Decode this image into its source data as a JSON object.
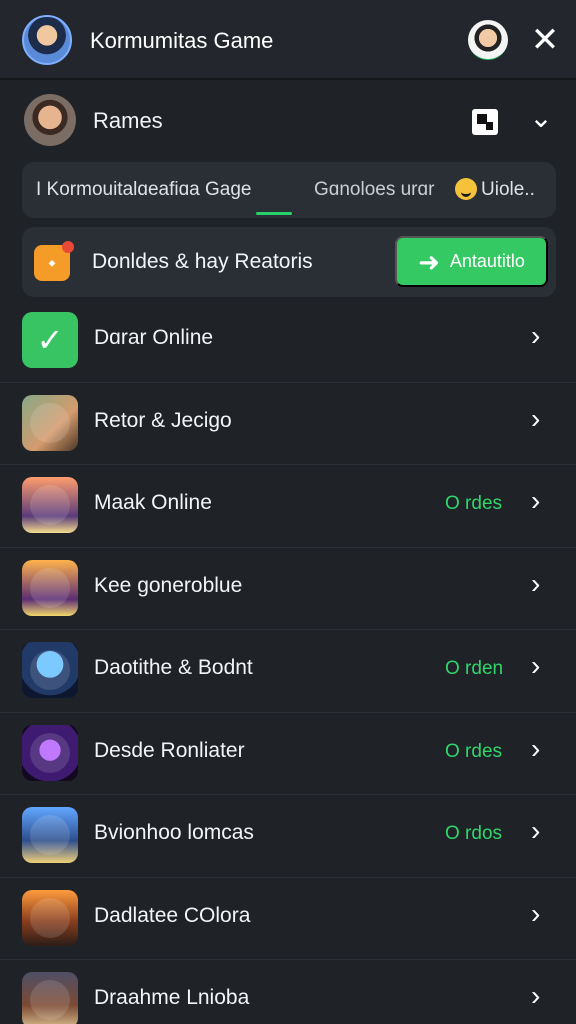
{
  "header": {
    "title": "Kormumitas Game"
  },
  "profile": {
    "name": "Rames"
  },
  "tabs": [
    {
      "label": "I  Kormouitalɑeafiɑa Gage"
    },
    {
      "label": "Gɑnoloes urɑr"
    },
    {
      "label": "Uiole.."
    }
  ],
  "promo": {
    "text": "Donldes & hay Reatoris",
    "cta": "Antautitlo"
  },
  "items": [
    {
      "label": "Dɑrar Online",
      "status": ""
    },
    {
      "label": "Retor & Jecigo",
      "status": ""
    },
    {
      "label": "Maak Online",
      "status": "O rdes"
    },
    {
      "label": "Kee goneroblue",
      "status": ""
    },
    {
      "label": "Daotithe & Bodnt",
      "status": "O rden"
    },
    {
      "label": "Desde Ronliater",
      "status": "O rdes"
    },
    {
      "label": "Bvionhoo lomcas",
      "status": "O rdos"
    },
    {
      "label": "Dadlatee COlora",
      "status": ""
    },
    {
      "label": "Draahme Lnioba",
      "status": ""
    }
  ],
  "colors": {
    "accent": "#34c963",
    "status": "#2fd66a",
    "promo_icon": "#f49b28"
  },
  "icons": {
    "header_avatar": "avatar-icon",
    "header_user": "user-avatar-icon",
    "close": "close-icon",
    "profile_avatar": "profile-avatar-icon",
    "qr": "qr-code-icon",
    "chevron": "chevron-down-icon",
    "item_chevron": "chevron-right-icon",
    "promo": "gift-icon",
    "cta": "arrow-icon",
    "check": "check-icon",
    "emoji": "smile-icon"
  }
}
